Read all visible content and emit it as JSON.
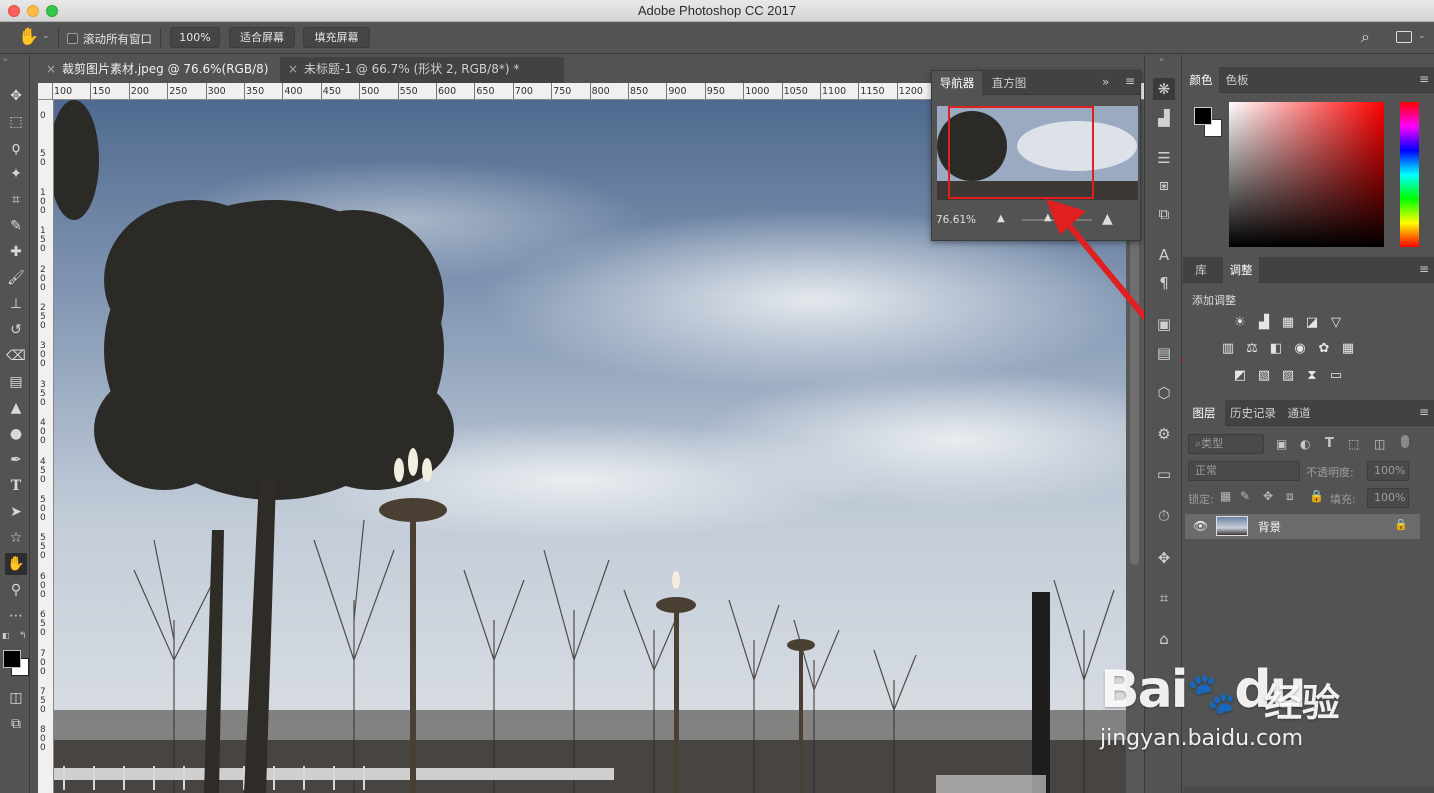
{
  "window": {
    "title": "Adobe Photoshop CC 2017"
  },
  "options_bar": {
    "scroll_all_label": "滚动所有窗口",
    "zoom_100_label": "100%",
    "fit_screen_label": "适合屏幕",
    "fill_screen_label": "填充屏幕"
  },
  "document_tabs": [
    {
      "title": "裁剪图片素材.jpeg @ 76.6%(RGB/8) *"
    },
    {
      "title": "未标题-1 @ 66.7% (形状 2, RGB/8*) *"
    }
  ],
  "ruler_top_ticks": [
    "100",
    "150",
    "200",
    "250",
    "300",
    "350",
    "400",
    "450",
    "500",
    "550",
    "600",
    "650",
    "700",
    "750",
    "800",
    "850",
    "900",
    "950",
    "1000",
    "1050",
    "1100",
    "1150",
    "1200"
  ],
  "ruler_left_ticks": [
    "0",
    "50",
    "100",
    "150",
    "200",
    "250",
    "300",
    "350",
    "400",
    "450",
    "500",
    "550",
    "600",
    "650",
    "700",
    "750",
    "800"
  ],
  "navigator": {
    "tabs": [
      "导航器",
      "直方图"
    ],
    "zoom_value": "76.61%"
  },
  "color_panel": {
    "tabs": [
      "颜色",
      "色板"
    ]
  },
  "adjust_panel": {
    "tabs": [
      "库",
      "调整"
    ],
    "heading": "添加调整",
    "icons": [
      "brightness-icon",
      "levels-icon",
      "curves-icon",
      "exposure-icon",
      "vibrance-icon",
      "hue-icon",
      "color-balance-icon",
      "black-white-icon",
      "photo-filter-icon",
      "channel-mixer-icon",
      "color-lookup-icon",
      "invert-icon",
      "posterize-icon",
      "threshold-icon",
      "gradient-map-icon",
      "selective-color-icon"
    ]
  },
  "layers_panel": {
    "tabs": [
      "图层",
      "历史记录",
      "通道"
    ],
    "filter_label": "类型",
    "blend_mode": "正常",
    "opacity_label": "不透明度:",
    "opacity_value": "100%",
    "lock_label": "锁定:",
    "fill_label": "填充:",
    "fill_value": "100%",
    "layers": [
      {
        "name": "背景"
      }
    ]
  },
  "watermark": {
    "brand": "Bai",
    "brand2": "du",
    "site_cn": "经验",
    "url": "jingyan.baidu.com"
  },
  "colors": {
    "accent_red": "#e02020",
    "panel_bg": "#535353"
  }
}
